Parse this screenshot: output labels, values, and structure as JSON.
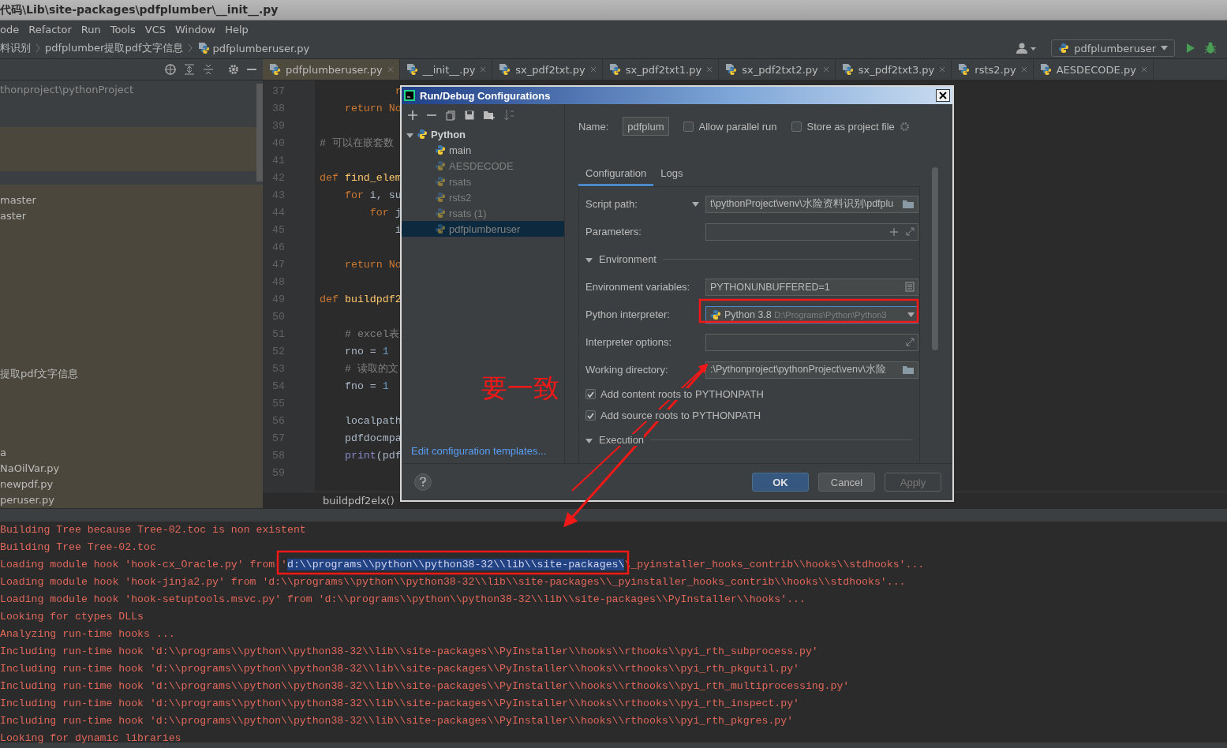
{
  "window": {
    "title": "代码\\Lib\\site-packages\\pdfplumber\\__init__.py"
  },
  "menu": [
    "ode",
    "Refactor",
    "Run",
    "Tools",
    "VCS",
    "Window",
    "Help"
  ],
  "breadcrumbs": [
    "料识别",
    "pdfplumber提取pdf文字信息",
    "pdfplumberuser.py"
  ],
  "run_config": {
    "label": "pdfplumberuser"
  },
  "editor_tabs": [
    {
      "label": "pdfplumberuser.py",
      "selected": true
    },
    {
      "label": "__init__.py",
      "selected": false
    },
    {
      "label": "sx_pdf2txt.py",
      "selected": false
    },
    {
      "label": "sx_pdf2txt1.py",
      "selected": false
    },
    {
      "label": "sx_pdf2txt2.py",
      "selected": false
    },
    {
      "label": "sx_pdf2txt3.py",
      "selected": false
    },
    {
      "label": "rsts2.py",
      "selected": false
    },
    {
      "label": "AESDECODE.py",
      "selected": false
    }
  ],
  "project_tree": {
    "header": "thonproject\\pythonProject",
    "items": [
      "master",
      "aster",
      "提取pdf文字信息",
      "a",
      "NaOilVar.py",
      "newpdf.py",
      "peruser.py"
    ]
  },
  "editor": {
    "breadcrumb": "buildpdf2elx()",
    "lines": [
      {
        "number": "37",
        "tokens": [
          {
            "text": "            r",
            "kind": "keyword"
          }
        ]
      },
      {
        "number": "38",
        "tokens": [
          {
            "text": "    return No",
            "kind": "keyword"
          }
        ]
      },
      {
        "number": "39"
      },
      {
        "number": "40",
        "tokens": [
          {
            "text": "# 可以在嵌套数",
            "kind": "comment"
          }
        ]
      },
      {
        "number": "41"
      },
      {
        "number": "42",
        "tokens": [
          {
            "text": "def",
            "kind": "keyword"
          },
          {
            "text": " find_elem",
            "kind": "function"
          }
        ]
      },
      {
        "number": "43",
        "tokens": [
          {
            "text": "    for",
            "kind": "keyword"
          },
          {
            "text": " i, su",
            "kind": "plain"
          }
        ]
      },
      {
        "number": "44",
        "tokens": [
          {
            "text": "        for",
            "kind": "keyword"
          },
          {
            "text": " j",
            "kind": "plain"
          }
        ]
      },
      {
        "number": "45",
        "tokens": [
          {
            "text": "            i",
            "kind": "plain"
          }
        ]
      },
      {
        "number": "46"
      },
      {
        "number": "47",
        "tokens": [
          {
            "text": "    return No",
            "kind": "keyword"
          }
        ]
      },
      {
        "number": "48"
      },
      {
        "number": "49",
        "tokens": [
          {
            "text": "def",
            "kind": "keyword"
          },
          {
            "text": " buildpdf2",
            "kind": "function"
          }
        ]
      },
      {
        "number": "50"
      },
      {
        "number": "51",
        "tokens": [
          {
            "text": "    # excel表",
            "kind": "comment"
          }
        ]
      },
      {
        "number": "52",
        "tokens": [
          {
            "text": "    rno = ",
            "kind": "plain"
          },
          {
            "text": "1",
            "kind": "number"
          }
        ]
      },
      {
        "number": "53",
        "tokens": [
          {
            "text": "    # 读取的文",
            "kind": "comment"
          }
        ]
      },
      {
        "number": "54",
        "tokens": [
          {
            "text": "    fno = ",
            "kind": "plain"
          },
          {
            "text": "1",
            "kind": "number"
          }
        ]
      },
      {
        "number": "55"
      },
      {
        "number": "56",
        "tokens": [
          {
            "text": "    localpath",
            "kind": "plain"
          }
        ]
      },
      {
        "number": "57",
        "tokens": [
          {
            "text": "    pdfdocmpa",
            "kind": "plain"
          }
        ]
      },
      {
        "number": "58",
        "tokens": [
          {
            "text": "    print",
            "kind": "builtin"
          },
          {
            "text": "(pdf",
            "kind": "plain"
          }
        ]
      },
      {
        "number": "59"
      }
    ]
  },
  "console": {
    "lines": [
      {
        "segments": [
          {
            "text": "Building Tree because Tree-02.toc is non existent",
            "selected": false
          }
        ]
      },
      {
        "segments": [
          {
            "text": "Building Tree Tree-02.toc",
            "selected": false
          }
        ]
      },
      {
        "segments": [
          {
            "text": "Loading module hook 'hook-cx_Oracle.py' from '",
            "selected": false
          },
          {
            "text": "d:\\\\programs\\\\python\\\\python38-32\\\\lib\\\\site-packages\\",
            "selected": true
          },
          {
            "text": "\\_pyinstaller_hooks_contrib\\\\hooks\\\\stdhooks'...",
            "selected": false
          }
        ]
      },
      {
        "segments": [
          {
            "text": "Loading module hook 'hook-jinja2.py' from 'd:\\\\programs\\\\python\\\\python38-32\\\\lib\\\\site-packages\\\\_pyinstaller_hooks_contrib\\\\hooks\\\\stdhooks'...",
            "selected": false
          }
        ]
      },
      {
        "segments": [
          {
            "text": "Loading module hook 'hook-setuptools.msvc.py' from 'd:\\\\programs\\\\python\\\\python38-32\\\\lib\\\\site-packages\\\\PyInstaller\\\\hooks'...",
            "selected": false
          }
        ]
      },
      {
        "segments": [
          {
            "text": "Looking for ctypes DLLs",
            "selected": false
          }
        ]
      },
      {
        "segments": [
          {
            "text": "Analyzing run-time hooks ...",
            "selected": false
          }
        ]
      },
      {
        "segments": [
          {
            "text": "Including run-time hook 'd:\\\\programs\\\\python\\\\python38-32\\\\lib\\\\site-packages\\\\PyInstaller\\\\hooks\\\\rthooks\\\\pyi_rth_subprocess.py'",
            "selected": false
          }
        ]
      },
      {
        "segments": [
          {
            "text": "Including run-time hook 'd:\\\\programs\\\\python\\\\python38-32\\\\lib\\\\site-packages\\\\PyInstaller\\\\hooks\\\\rthooks\\\\pyi_rth_pkgutil.py'",
            "selected": false
          }
        ]
      },
      {
        "segments": [
          {
            "text": "Including run-time hook 'd:\\\\programs\\\\python\\\\python38-32\\\\lib\\\\site-packages\\\\PyInstaller\\\\hooks\\\\rthooks\\\\pyi_rth_multiprocessing.py'",
            "selected": false
          }
        ]
      },
      {
        "segments": [
          {
            "text": "Including run-time hook 'd:\\\\programs\\\\python\\\\python38-32\\\\lib\\\\site-packages\\\\PyInstaller\\\\hooks\\\\rthooks\\\\pyi_rth_inspect.py'",
            "selected": false
          }
        ]
      },
      {
        "segments": [
          {
            "text": "Including run-time hook 'd:\\\\programs\\\\python\\\\python38-32\\\\lib\\\\site-packages\\\\PyInstaller\\\\hooks\\\\rthooks\\\\pyi_rth_pkgres.py'",
            "selected": false
          }
        ]
      },
      {
        "segments": [
          {
            "text": "Looking for dynamic libraries",
            "selected": false
          }
        ]
      }
    ]
  },
  "dialog": {
    "title": "Run/Debug Configurations",
    "tree": {
      "label": "Python",
      "expanded": true,
      "children": [
        {
          "label": "main",
          "temporary": false,
          "selected": false
        },
        {
          "label": "AESDECODE",
          "temporary": true,
          "selected": false
        },
        {
          "label": "rsats",
          "temporary": true,
          "selected": false
        },
        {
          "label": "rsts2",
          "temporary": true,
          "selected": false
        },
        {
          "label": "rsats (1)",
          "temporary": true,
          "selected": false
        },
        {
          "label": "pdfplumberuser",
          "temporary": true,
          "selected": true
        }
      ]
    },
    "templates_link": "Edit configuration templates...",
    "name_label": "Name:",
    "name_value": "pdfplum",
    "options": [
      {
        "label": "Allow parallel run",
        "checked": false
      },
      {
        "label": "Store as project file",
        "checked": false
      }
    ],
    "tabs": [
      {
        "label": "Configuration",
        "selected": true
      },
      {
        "label": "Logs",
        "selected": false
      }
    ],
    "rows": [
      {
        "kind": "path",
        "label": "Script path:",
        "value": "t\\pythonProject\\venv\\水险资料识别\\pdfplu"
      },
      {
        "kind": "params",
        "label": "Parameters:"
      },
      {
        "kind": "section",
        "label": "Environment",
        "expanded": true
      },
      {
        "kind": "env",
        "label": "Environment variables:",
        "value": "PYTHONUNBUFFERED=1"
      },
      {
        "kind": "interpreter",
        "label": "Python interpreter:",
        "value": "Python 3.8",
        "detail": "D:\\Programs\\Python\\Python3"
      },
      {
        "kind": "options",
        "label": "Interpreter options:"
      },
      {
        "kind": "folder",
        "label": "Working directory:",
        "value": ":\\Pythonproject\\pythonProject\\venv\\水险"
      },
      {
        "kind": "check",
        "label": "Add content roots to PYTHONPATH",
        "checked": true
      },
      {
        "kind": "check",
        "label": "Add source roots to PYTHONPATH",
        "checked": true
      },
      {
        "kind": "section",
        "label": "Execution",
        "expanded": true
      }
    ],
    "buttons": [
      {
        "label": "OK",
        "kind": "primary",
        "disabled": false
      },
      {
        "label": "Cancel",
        "kind": "normal",
        "disabled": false
      },
      {
        "label": "Apply",
        "kind": "normal",
        "disabled": true
      }
    ]
  },
  "annotation": {
    "note": "要一致"
  }
}
